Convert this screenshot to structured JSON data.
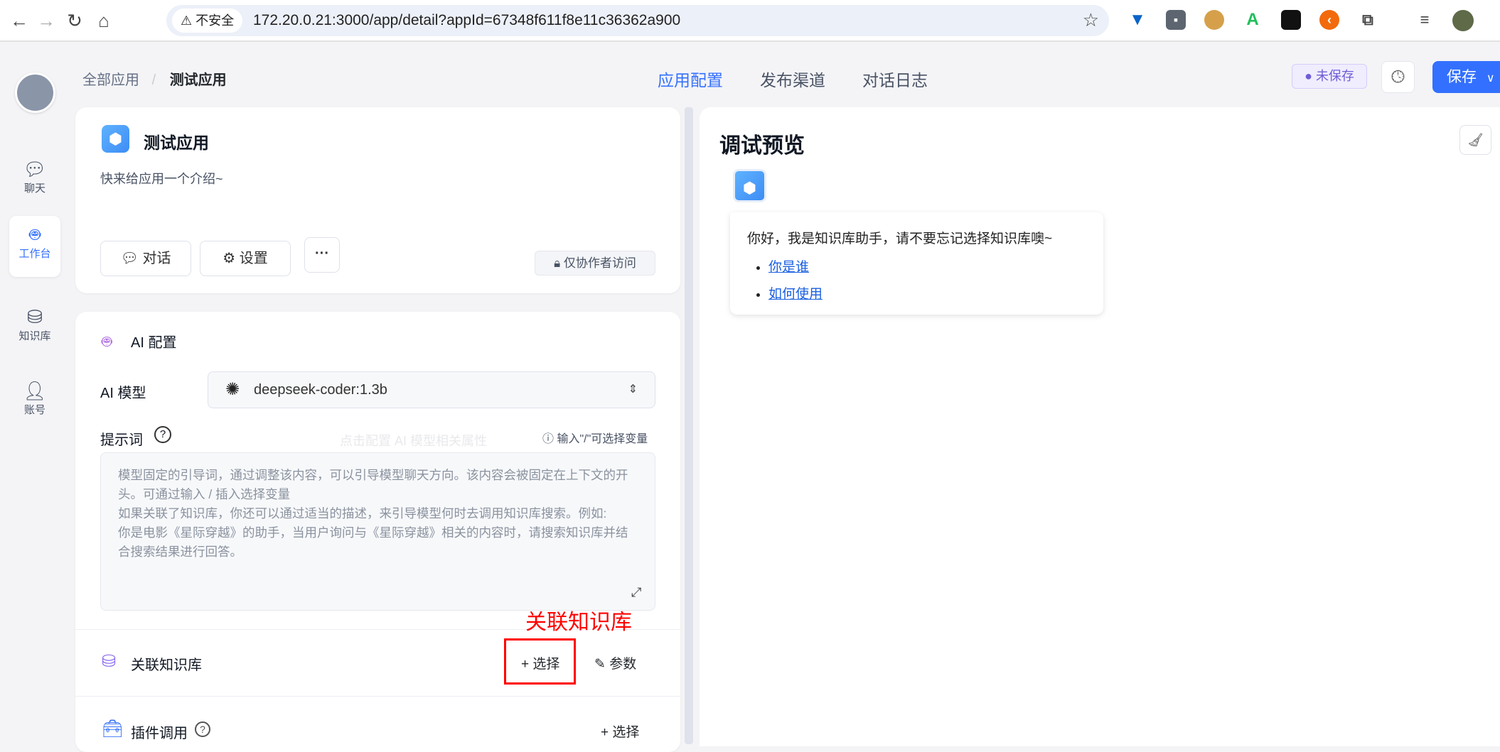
{
  "browser": {
    "insecure_label": "不安全",
    "url": "172.20.0.21:3000/app/detail?appId=67348f611f8e11c36362a900"
  },
  "sidebar": {
    "items": [
      {
        "label": "聊天"
      },
      {
        "label": "工作台"
      },
      {
        "label": "知识库"
      },
      {
        "label": "账号"
      }
    ]
  },
  "header": {
    "breadcrumb": [
      "全部应用",
      "测试应用"
    ],
    "tabs": [
      "应用配置",
      "发布渠道",
      "对话日志"
    ],
    "status": "未保存",
    "save_label": "保存"
  },
  "app": {
    "name": "测试应用",
    "intro": "快来给应用一个介绍~",
    "chat_btn": "对话",
    "settings_btn": "设置",
    "access": "仅协作者访问"
  },
  "ai_config": {
    "title": "AI 配置",
    "model_label": "AI 模型",
    "model": "deepseek-coder:1.3b",
    "prompt_label": "提示词",
    "prompt_hint": "输入\"/\"可选择变量",
    "tooltip": "点击配置 AI 模型相关属性",
    "prompt_placeholder": "模型固定的引导词，通过调整该内容，可以引导模型聊天方向。该内容会被固定在上下文的开头。可通过输入 / 插入选择变量\n如果关联了知识库，你还可以通过适当的描述，来引导模型何时去调用知识库搜索。例如:\n你是电影《星际穿越》的助手，当用户询问与《星际穿越》相关的内容时，请搜索知识库并结合搜索结果进行回答。"
  },
  "knowledge": {
    "title": "关联知识库",
    "select": "+ 选择",
    "params": "参数",
    "annotation": "关联知识库"
  },
  "plugins": {
    "title": "插件调用",
    "select": "+ 选择"
  },
  "preview": {
    "title": "调试预览",
    "greeting": "你好，我是知识库助手，请不要忘记选择知识库噢~",
    "links": [
      "你是谁",
      "如何使用"
    ]
  }
}
